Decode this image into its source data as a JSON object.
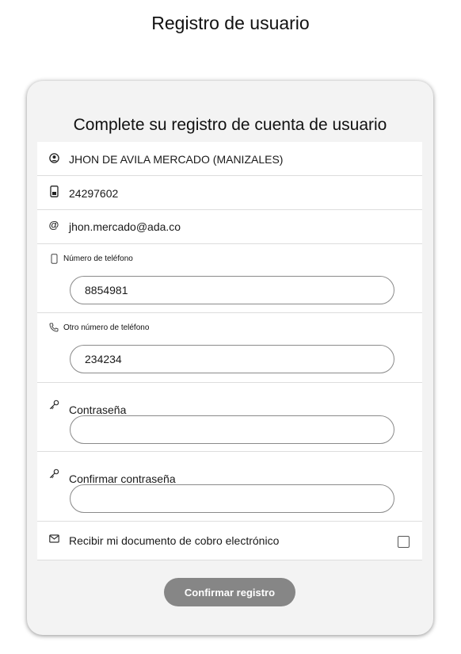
{
  "page": {
    "title": "Registro de usuario"
  },
  "card": {
    "title": "Complete su registro de cuenta de usuario"
  },
  "user": {
    "name": "JHON DE AVILA MERCADO (MANIZALES)",
    "document": "24297602",
    "email": "jhon.mercado@ada.co"
  },
  "phone": {
    "label": "Número de teléfono",
    "value": "8854981"
  },
  "other_phone": {
    "label": "Otro número de teléfono",
    "value": "234234"
  },
  "password": {
    "label": "Contraseña",
    "value": ""
  },
  "confirm_password": {
    "label": "Confirmar contraseña",
    "value": ""
  },
  "electronic_billing": {
    "label": "Recibir mi documento de cobro electrónico",
    "checked": false
  },
  "actions": {
    "confirm_label": "Confirmar registro"
  },
  "icons": {
    "name": "user-circle-icon",
    "document": "id-card-icon",
    "email": "at-sign-icon",
    "phone": "mobile-phone-icon",
    "other_phone": "phone-icon",
    "password": "key-icon",
    "confirm_password": "key-icon",
    "electronic_billing": "envelope-icon"
  },
  "colors": {
    "card_background": "#f3f3f3",
    "button_background": "#868686",
    "button_text": "#ffffff"
  }
}
